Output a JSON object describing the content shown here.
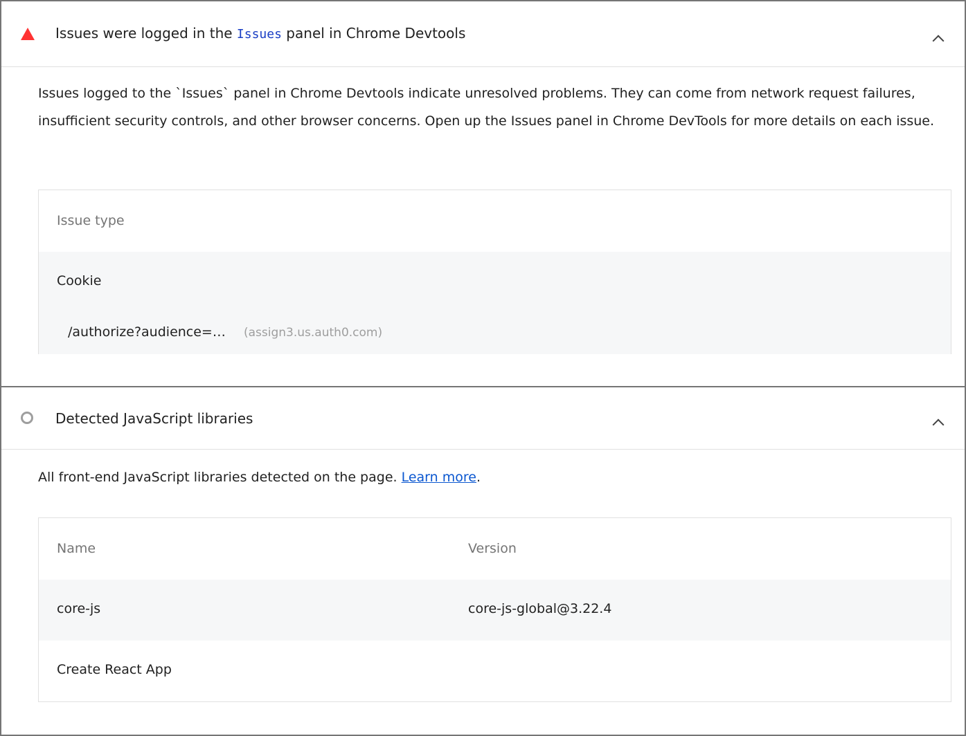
{
  "issues_audit": {
    "title_pre": "Issues were logged in the ",
    "title_code": "Issues",
    "title_post": " panel in Chrome Devtools",
    "status": "fail",
    "status_color": "#ff3333",
    "description": "Issues logged to the `Issues` panel in Chrome Devtools indicate unresolved problems. They can come from network request failures, insufficient security controls, and other browser concerns. Open up the Issues panel in Chrome DevTools for more details on each issue.",
    "table": {
      "header": "Issue type",
      "rows": [
        {
          "type": "Cookie",
          "subitems": [
            {
              "url": "/authorize?audience=…",
              "host": "(assign3.us.auth0.com)"
            }
          ]
        }
      ]
    }
  },
  "libraries_audit": {
    "title": "Detected JavaScript libraries",
    "status": "informative",
    "description_pre": "All front-end JavaScript libraries detected on the page. ",
    "learn_more": "Learn more",
    "description_post": ".",
    "table": {
      "headers": [
        "Name",
        "Version"
      ],
      "rows": [
        {
          "name": "core-js",
          "version": "core-js-global@3.22.4"
        },
        {
          "name": "Create React App",
          "version": ""
        }
      ]
    }
  },
  "icons": {
    "fail": "warning-triangle-icon",
    "info": "circle-icon",
    "collapse": "chevron-up-icon"
  }
}
